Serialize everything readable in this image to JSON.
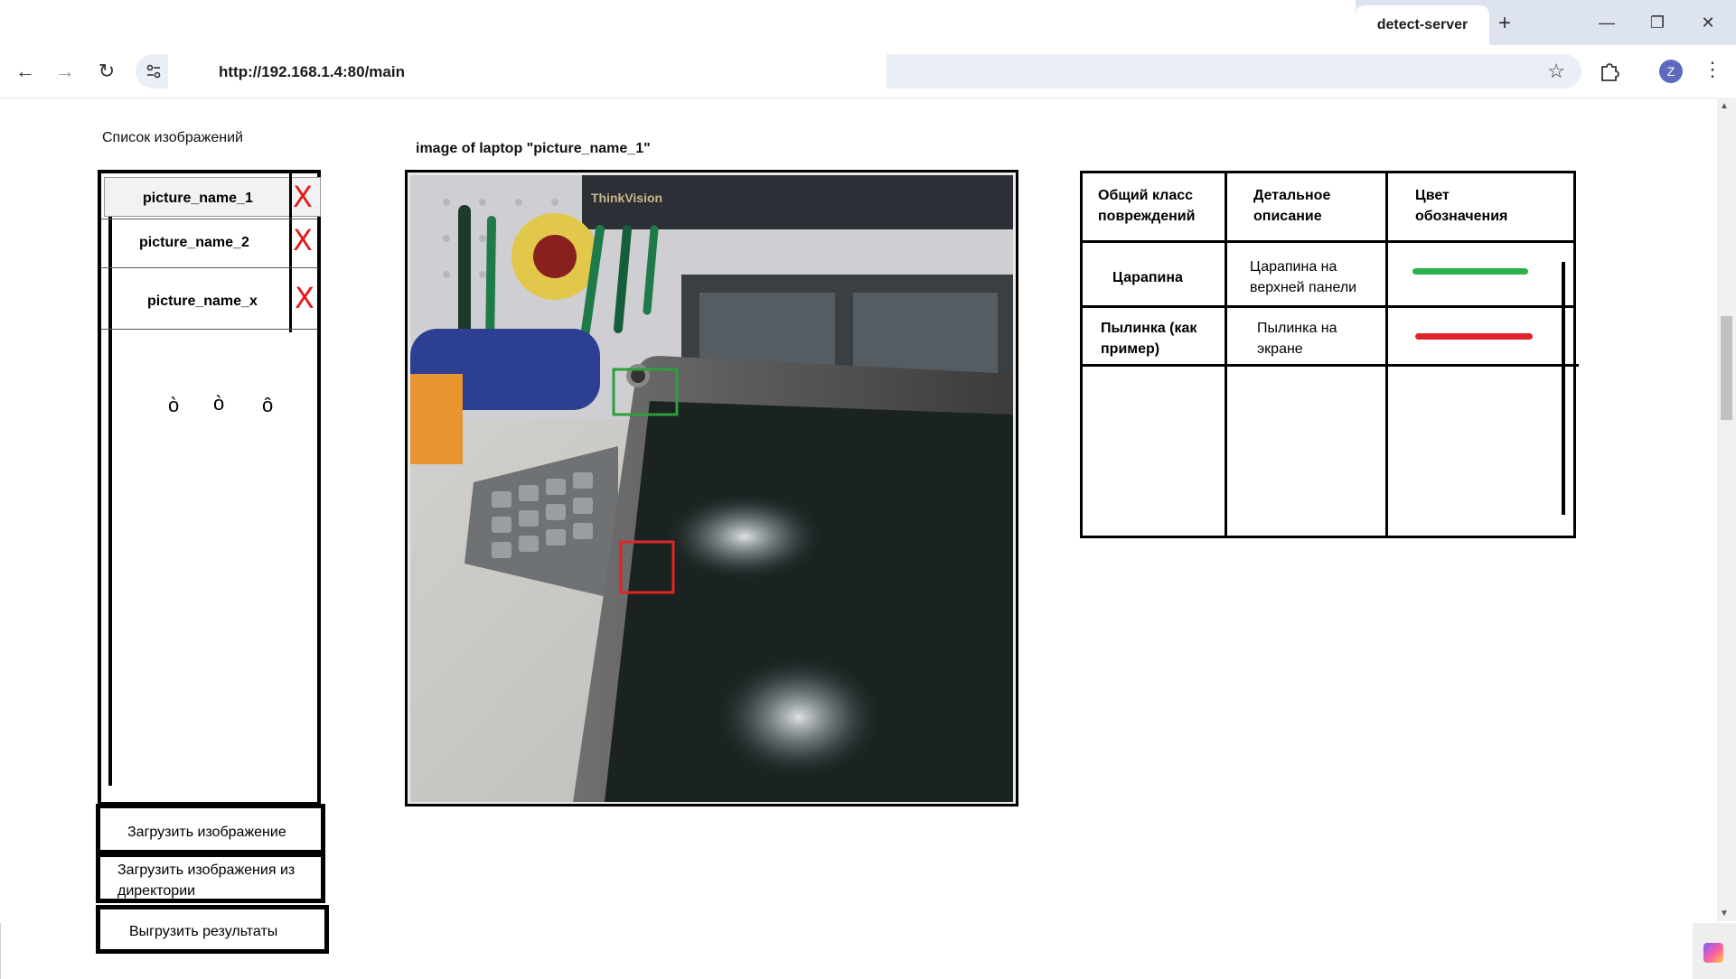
{
  "browser": {
    "tab_title": "detect-server",
    "new_tab": "+",
    "url": "http://192.168.1.4:80/main",
    "profile_initial": "Z",
    "minimize": "—",
    "restore": "❐",
    "close": "✕"
  },
  "sidebar": {
    "title": "Список изображений",
    "items": [
      {
        "label": "picture_name_1",
        "selected": true
      },
      {
        "label": "picture_name_2",
        "selected": false
      },
      {
        "label": "picture_name_x",
        "selected": false
      }
    ],
    "delete_glyph": "X",
    "loading_dots": [
      "ò",
      "ò",
      "ô"
    ],
    "buttons": {
      "upload_image": "Загрузить изображение",
      "upload_directory": "Загрузить изображения из директории",
      "export_results": "Выгрузить результаты"
    }
  },
  "viewer": {
    "title": "image of laptop \"picture_name_1\"",
    "photo_brand_text": "ThinkVision",
    "boxes": [
      {
        "color": "#2e9e3e",
        "label": "Царапина"
      },
      {
        "color": "#e02626",
        "label": "Пылинка"
      }
    ]
  },
  "legend_table": {
    "headers": [
      "Общий класс повреждений",
      "Детальное описание",
      "Цвет обозначения"
    ],
    "rows": [
      {
        "class": "Царапина",
        "description": "Царапина на верхней панели",
        "color": "#2bb24c"
      },
      {
        "class": "Пылинка (как пример)",
        "description": "Пылинка на экране",
        "color": "#e0242c"
      }
    ]
  }
}
